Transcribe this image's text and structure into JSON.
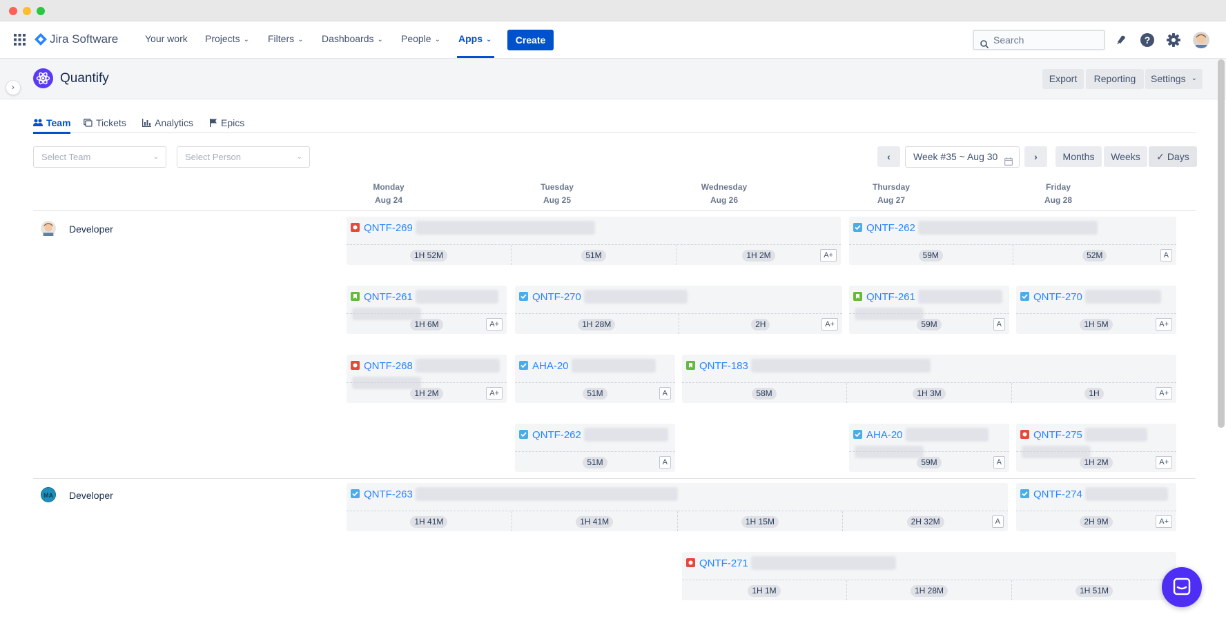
{
  "nav": {
    "brand": "Jira Software",
    "items": [
      {
        "label": "Your work"
      },
      {
        "label": "Projects"
      },
      {
        "label": "Filters"
      },
      {
        "label": "Dashboards"
      },
      {
        "label": "People"
      },
      {
        "label": "Apps"
      }
    ],
    "active_item": "Apps",
    "create_label": "Create",
    "search_placeholder": "Search"
  },
  "app": {
    "name": "Quantify",
    "export_label": "Export",
    "reporting_label": "Reporting",
    "settings_label": "Settings"
  },
  "tabs": [
    {
      "label": "Team",
      "icon": "people-icon",
      "active": true
    },
    {
      "label": "Tickets",
      "icon": "tickets-icon",
      "active": false
    },
    {
      "label": "Analytics",
      "icon": "bar-chart-icon",
      "active": false
    },
    {
      "label": "Epics",
      "icon": "flag-icon",
      "active": false
    }
  ],
  "filters": {
    "team_placeholder": "Select Team",
    "person_placeholder": "Select Person"
  },
  "period": {
    "week_label": "Week #35 ~ Aug 30",
    "prev_icon": "chevron-left-icon",
    "next_icon": "chevron-right-icon",
    "views": [
      {
        "label": "Months",
        "selected": false
      },
      {
        "label": "Weeks",
        "selected": false
      },
      {
        "label": "Days",
        "selected": true
      }
    ]
  },
  "days": [
    {
      "name": "Monday",
      "date": "Aug 24"
    },
    {
      "name": "Tuesday",
      "date": "Aug 25"
    },
    {
      "name": "Wednesday",
      "date": "Aug 26"
    },
    {
      "name": "Thursday",
      "date": "Aug 27"
    },
    {
      "name": "Friday",
      "date": "Aug 28"
    }
  ],
  "people": [
    {
      "name": "Developer",
      "avatar": "avatar-face",
      "cards": [
        {
          "key": "QNTF-269",
          "type": "bug",
          "days": [
            0,
            2
          ],
          "lane": 0,
          "times": [
            "1H 52M",
            "51M",
            "1H 2M"
          ],
          "badge": "A+"
        },
        {
          "key": "QNTF-262",
          "type": "task",
          "days": [
            3,
            4
          ],
          "lane": 0,
          "times": [
            "59M",
            "52M"
          ],
          "badge": "A"
        },
        {
          "key": "QNTF-261",
          "type": "story",
          "days": [
            0,
            0
          ],
          "lane": 1,
          "times": [
            "1H 6M"
          ],
          "badge": "A+"
        },
        {
          "key": "QNTF-270",
          "type": "task",
          "days": [
            1,
            2
          ],
          "lane": 1,
          "times": [
            "1H 28M",
            "2H"
          ],
          "badge": "A+"
        },
        {
          "key": "QNTF-261",
          "type": "story",
          "days": [
            3,
            3
          ],
          "lane": 1,
          "times": [
            "59M"
          ],
          "badge": "A"
        },
        {
          "key": "QNTF-270",
          "type": "task",
          "days": [
            4,
            4
          ],
          "lane": 1,
          "times": [
            "1H 5M"
          ],
          "badge": "A+"
        },
        {
          "key": "QNTF-268",
          "type": "bug",
          "days": [
            0,
            0
          ],
          "lane": 2,
          "times": [
            "1H 2M"
          ],
          "badge": "A+"
        },
        {
          "key": "AHA-20",
          "type": "task",
          "days": [
            1,
            1
          ],
          "lane": 2,
          "times": [
            "51M"
          ],
          "badge": "A"
        },
        {
          "key": "QNTF-183",
          "type": "story",
          "days": [
            2,
            4
          ],
          "lane": 2,
          "times": [
            "58M",
            "1H 3M",
            "1H"
          ],
          "badge": "A+"
        },
        {
          "key": "QNTF-262",
          "type": "task",
          "days": [
            1,
            1
          ],
          "lane": 3,
          "times": [
            "51M"
          ],
          "badge": "A"
        },
        {
          "key": "AHA-20",
          "type": "task",
          "days": [
            3,
            3
          ],
          "lane": 3,
          "times": [
            "59M"
          ],
          "badge": "A"
        },
        {
          "key": "QNTF-275",
          "type": "bug",
          "days": [
            4,
            4
          ],
          "lane": 3,
          "times": [
            "1H 2M"
          ],
          "badge": "A+"
        }
      ]
    },
    {
      "name": "Developer",
      "avatar": "MA",
      "cards": [
        {
          "key": "QNTF-263",
          "type": "task",
          "days": [
            0,
            3
          ],
          "lane": 0,
          "times": [
            "1H 41M",
            "1H 41M",
            "1H 15M",
            "2H 32M"
          ],
          "badge": "A"
        },
        {
          "key": "QNTF-274",
          "type": "task",
          "days": [
            4,
            4
          ],
          "lane": 0,
          "times": [
            "2H 9M"
          ],
          "badge": "A+"
        },
        {
          "key": "QNTF-271",
          "type": "bug",
          "days": [
            2,
            4
          ],
          "lane": 1,
          "times": [
            "1H 1M",
            "1H 28M",
            "1H 51M"
          ],
          "badge": ""
        }
      ]
    }
  ],
  "colors": {
    "primary": "#0052cc",
    "link": "#2684ff",
    "bug": "#e5493a",
    "task": "#4bade8",
    "story": "#63ba3c",
    "chat": "#4e2df5"
  },
  "icons": {
    "apps_grid": "grid-icon",
    "notifications": "notification-icon",
    "help": "help-icon",
    "settings": "gear-icon",
    "profile": "avatar"
  }
}
